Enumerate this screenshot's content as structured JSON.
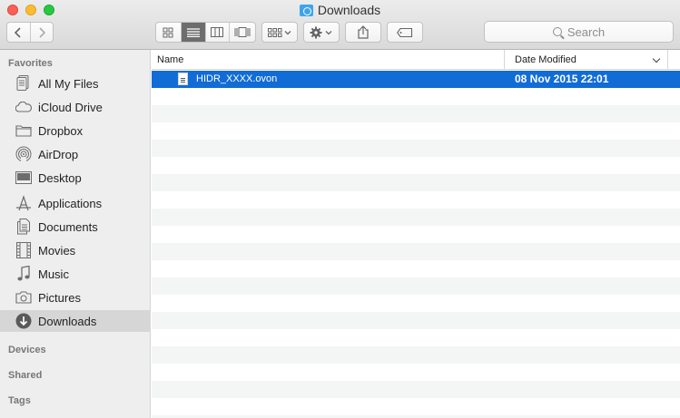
{
  "window": {
    "title": "Downloads"
  },
  "toolbar": {
    "back_icon": "chevron-left-icon",
    "forward_icon": "chevron-right-icon",
    "view_modes": [
      "icon-view",
      "list-view",
      "column-view",
      "cover-flow-view"
    ],
    "active_view": "list-view",
    "search_placeholder": "Search"
  },
  "sidebar": {
    "favorites_label": "Favorites",
    "devices_label": "Devices",
    "shared_label": "Shared",
    "tags_label": "Tags",
    "items": [
      {
        "label": "All My Files",
        "icon": "all-files-icon"
      },
      {
        "label": "iCloud Drive",
        "icon": "cloud-icon"
      },
      {
        "label": "Dropbox",
        "icon": "folder-icon"
      },
      {
        "label": "AirDrop",
        "icon": "airdrop-icon"
      },
      {
        "label": "Desktop",
        "icon": "desktop-icon"
      },
      {
        "label": "Applications",
        "icon": "applications-icon"
      },
      {
        "label": "Documents",
        "icon": "documents-icon"
      },
      {
        "label": "Movies",
        "icon": "film-icon"
      },
      {
        "label": "Music",
        "icon": "music-note-icon"
      },
      {
        "label": "Pictures",
        "icon": "camera-icon"
      },
      {
        "label": "Downloads",
        "icon": "download-icon",
        "selected": true
      }
    ]
  },
  "list": {
    "columns": {
      "name": "Name",
      "date": "Date Modified"
    },
    "files": [
      {
        "name": "HIDR_XXXX.ovon",
        "date": "08 Nov 2015 22:01",
        "selected": true
      }
    ]
  },
  "colors": {
    "selection": "#116cd6",
    "sidebar_bg": "#eeeeee"
  }
}
